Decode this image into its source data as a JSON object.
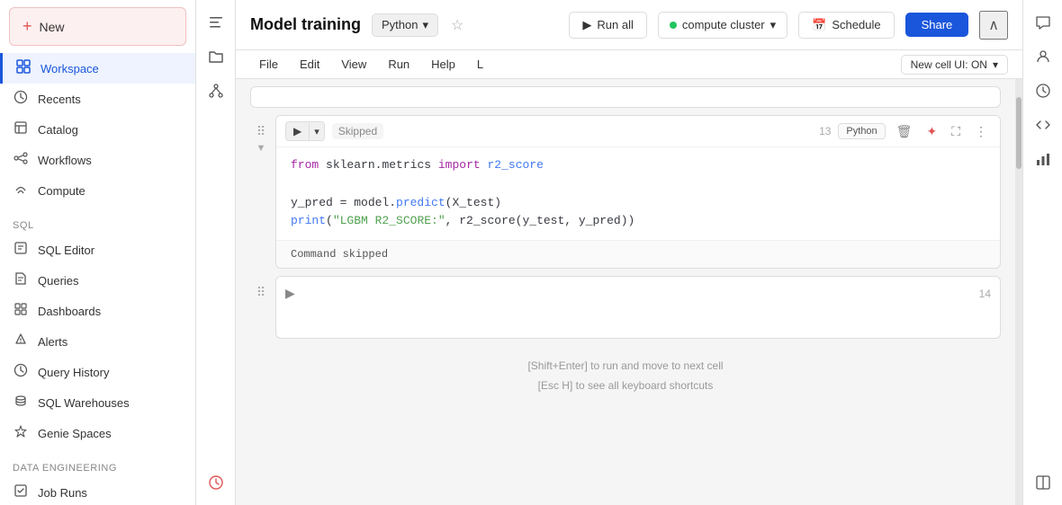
{
  "sidebar": {
    "new_label": "New",
    "items": [
      {
        "id": "workspace",
        "label": "Workspace",
        "icon": "⬡",
        "active": true
      },
      {
        "id": "recents",
        "label": "Recents",
        "icon": "🕐",
        "active": false
      },
      {
        "id": "catalog",
        "label": "Catalog",
        "icon": "📖",
        "active": false
      },
      {
        "id": "workflows",
        "label": "Workflows",
        "icon": "⚙",
        "active": false
      },
      {
        "id": "compute",
        "label": "Compute",
        "icon": "☁",
        "active": false
      }
    ],
    "sql_section": "SQL",
    "sql_items": [
      {
        "id": "sql-editor",
        "label": "SQL Editor",
        "icon": "⬡"
      },
      {
        "id": "queries",
        "label": "Queries",
        "icon": "📄"
      },
      {
        "id": "dashboards",
        "label": "Dashboards",
        "icon": "⊞"
      },
      {
        "id": "alerts",
        "label": "Alerts",
        "icon": "🔔"
      },
      {
        "id": "query-history",
        "label": "Query History",
        "icon": "🕐"
      },
      {
        "id": "sql-warehouses",
        "label": "SQL Warehouses",
        "icon": "⊡"
      },
      {
        "id": "genie-spaces",
        "label": "Genie Spaces",
        "icon": "✦"
      }
    ],
    "data_engineering_section": "Data Engineering",
    "data_engineering_items": [
      {
        "id": "job-runs",
        "label": "Job Runs",
        "icon": "⊡"
      }
    ]
  },
  "topbar": {
    "title": "Model training",
    "language": "Python",
    "run_all_label": "Run all",
    "cluster_label": "compute cluster",
    "schedule_label": "Schedule",
    "share_label": "Share"
  },
  "menubar": {
    "file_label": "File",
    "edit_label": "Edit",
    "view_label": "View",
    "run_label": "Run",
    "help_label": "Help",
    "shortcut_label": "L",
    "new_cell_toggle": "New cell UI: ON"
  },
  "cells": [
    {
      "id": "cell-13",
      "number": 13,
      "status": "Skipped",
      "language": "Python",
      "code_lines": [
        {
          "type": "import",
          "text": "from sklearn.metrics import r2_score"
        },
        {
          "type": "blank"
        },
        {
          "type": "code",
          "text": "y_pred = model.predict(X_test)"
        },
        {
          "type": "code",
          "text": "print(\"LGBM R2_SCORE:\", r2_score(y_test, y_pred))"
        }
      ],
      "output": "Command skipped"
    },
    {
      "id": "cell-14",
      "number": 14,
      "status": "",
      "language": "",
      "code_lines": [],
      "output": ""
    }
  ],
  "hints": {
    "line1": "[Shift+Enter] to run and move to next cell",
    "line2": "[Esc H] to see all keyboard shortcuts"
  },
  "right_panel": {
    "icons": [
      {
        "id": "comments-icon",
        "symbol": "💬"
      },
      {
        "id": "user-icon",
        "symbol": "👤"
      },
      {
        "id": "history-icon",
        "symbol": "🕐"
      },
      {
        "id": "code-icon",
        "symbol": "⟨/⟩"
      },
      {
        "id": "chart-icon",
        "symbol": "📊"
      }
    ],
    "bottom_icons": [
      {
        "id": "expand-icon",
        "symbol": "⊡"
      }
    ]
  }
}
